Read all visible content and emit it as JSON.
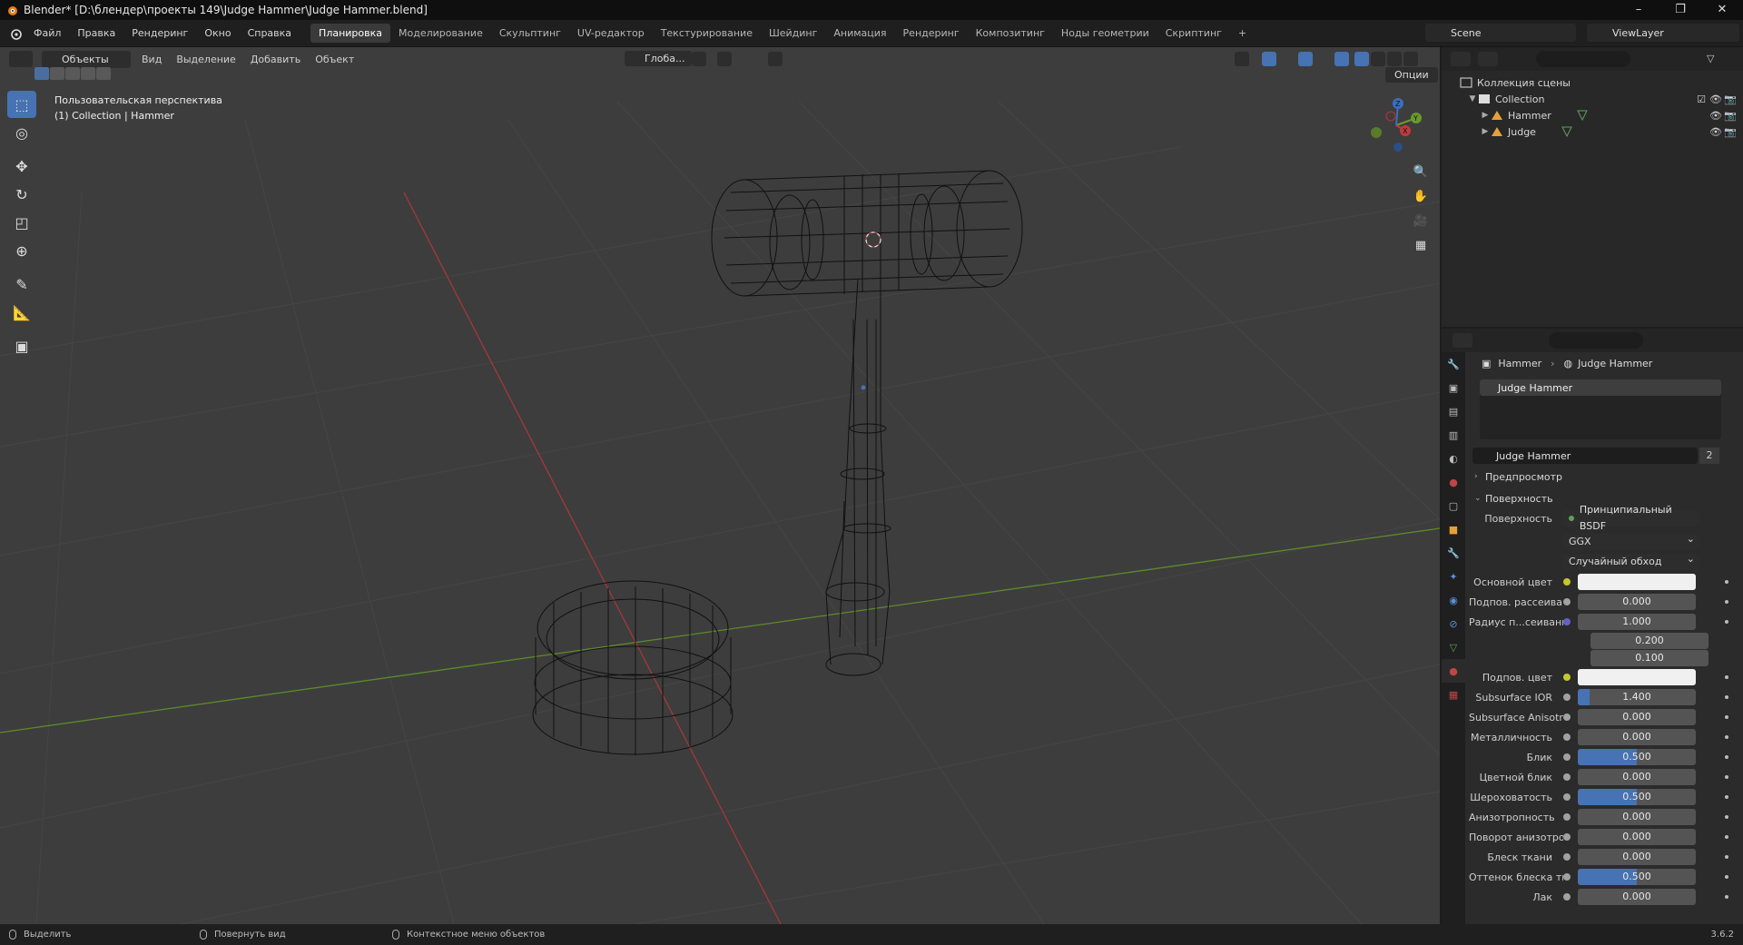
{
  "window": {
    "title": "Blender* [D:\\блендер\\проекты 149\\Judge Hammer\\Judge Hammer.blend]",
    "minimize": "–",
    "maximize": "❐",
    "close": "✕"
  },
  "topbar": {
    "menus": [
      "Файл",
      "Правка",
      "Рендеринг",
      "Окно",
      "Справка"
    ],
    "workspaces": [
      "Планировка",
      "Моделирование",
      "Скульптинг",
      "UV-редактор",
      "Текстурирование",
      "Шейдинг",
      "Анимация",
      "Рендеринг",
      "Композитинг",
      "Ноды геометрии",
      "Скриптинг",
      "+"
    ],
    "active_workspace": "Планировка",
    "scene": "Scene",
    "view_layer": "ViewLayer"
  },
  "viewport": {
    "mode": "Объекты",
    "menus": [
      "Вид",
      "Выделение",
      "Добавить",
      "Объект"
    ],
    "orientation": "Глоба...",
    "options": "Опции",
    "info_line1": "Пользовательская перспектива",
    "info_line2": "(1) Collection | Hammer",
    "gizmo": {
      "x": "X",
      "y": "Y",
      "z": "Z"
    }
  },
  "outliner": {
    "root": "Коллекция сцены",
    "collection": "Collection",
    "objects": [
      "Hammer",
      "Judge"
    ]
  },
  "properties": {
    "breadcrumb_object": "Hammer",
    "breadcrumb_material": "Judge Hammer",
    "slot": "Judge Hammer",
    "material_name": "Judge Hammer",
    "material_users": "2",
    "panel_preview": "Предпросмотр",
    "panel_surface": "Поверхность",
    "surface_label": "Поверхность",
    "surface_shader": "Принципиальный BSDF",
    "distribution": "GGX",
    "subsurface_method": "Случайный обход",
    "rows": [
      {
        "label": "Основной цвет",
        "type": "color",
        "dot": "#c7c729"
      },
      {
        "label": "Подпов. рассеива...",
        "type": "num",
        "value": "0.000",
        "fill": 0,
        "dot": "#a1a1a1"
      },
      {
        "label": "Радиус п...сеивания",
        "type": "num",
        "value": "1.000",
        "fill": 0,
        "dot": "#6363c7"
      },
      {
        "label": "",
        "type": "sub",
        "value": "0.200"
      },
      {
        "label": "",
        "type": "sub",
        "value": "0.100"
      },
      {
        "label": "Подпов. цвет",
        "type": "color",
        "dot": "#c7c729"
      },
      {
        "label": "Subsurface IOR",
        "type": "num",
        "value": "1.400",
        "fill": 0.1,
        "dot": "#a1a1a1"
      },
      {
        "label": "Subsurface Anisotr...",
        "type": "num",
        "value": "0.000",
        "fill": 0,
        "dot": "#a1a1a1"
      },
      {
        "label": "Металличность",
        "type": "num",
        "value": "0.000",
        "fill": 0,
        "dot": "#a1a1a1"
      },
      {
        "label": "Блик",
        "type": "num",
        "value": "0.500",
        "fill": 0.5,
        "dot": "#a1a1a1"
      },
      {
        "label": "Цветной блик",
        "type": "num",
        "value": "0.000",
        "fill": 0,
        "dot": "#a1a1a1"
      },
      {
        "label": "Шероховатость",
        "type": "num",
        "value": "0.500",
        "fill": 0.5,
        "dot": "#a1a1a1"
      },
      {
        "label": "Анизотропность",
        "type": "num",
        "value": "0.000",
        "fill": 0,
        "dot": "#a1a1a1"
      },
      {
        "label": "Поворот анизотро...",
        "type": "num",
        "value": "0.000",
        "fill": 0,
        "dot": "#a1a1a1"
      },
      {
        "label": "Блеск ткани",
        "type": "num",
        "value": "0.000",
        "fill": 0,
        "dot": "#a1a1a1"
      },
      {
        "label": "Оттенок блеска тк...",
        "type": "num",
        "value": "0.500",
        "fill": 0.5,
        "dot": "#a1a1a1"
      },
      {
        "label": "Лак",
        "type": "num",
        "value": "0.000",
        "fill": 0,
        "dot": "#a1a1a1"
      }
    ]
  },
  "statusbar": {
    "select": "Выделить",
    "rotate": "Повернуть вид",
    "context": "Контекстное меню объектов",
    "version": "3.6.2"
  },
  "colors": {
    "accent": "#4772b3",
    "x_axis": "#c13b3b",
    "y_axis": "#6a9a2a",
    "origin": "#e6a03a"
  }
}
